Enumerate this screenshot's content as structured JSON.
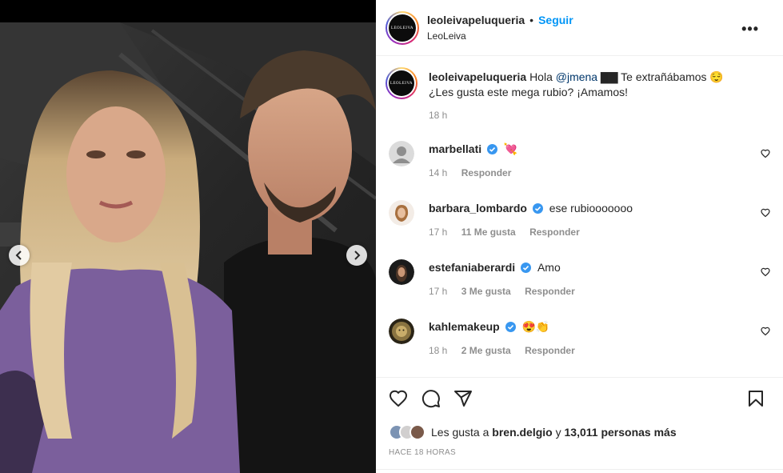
{
  "post": {
    "username": "leoleivapeluqueria",
    "follow_label": "Seguir",
    "subtitle": "LeoLeiva",
    "avatar_text": "LEOLEIVA",
    "more_label": "•••"
  },
  "caption": {
    "username": "leoleivapeluqueria",
    "text_before": "Hola ",
    "mention": "@jmena",
    "text_after": " ▇▇ Te extrañábamos 😌",
    "line2": "¿Les gusta este mega rubio? ¡Amamos!",
    "time": "18 h"
  },
  "comments": [
    {
      "username": "marbellati",
      "text": "💘",
      "time": "14 h",
      "likes": "",
      "reply": "Responder"
    },
    {
      "username": "barbara_lombardo",
      "text": "ese rubiooooooo",
      "time": "17 h",
      "likes": "11 Me gusta",
      "reply": "Responder"
    },
    {
      "username": "estefaniaberardi",
      "text": "Amo",
      "time": "17 h",
      "likes": "3 Me gusta",
      "reply": "Responder"
    },
    {
      "username": "kahlemakeup",
      "text": "😍👏",
      "time": "18 h",
      "likes": "2 Me gusta",
      "reply": "Responder"
    }
  ],
  "likes": {
    "prefix": "Les gusta a ",
    "user": "bren.delgio",
    "middle": " y ",
    "count": "13,011 personas más"
  },
  "time_ago": "HACE 18 HORAS",
  "colors": {
    "accent": "#0095f6",
    "verified": "#3897f0",
    "muted": "#8e8e8e",
    "text": "#262626"
  },
  "icons": [
    "chevron-left-icon",
    "chevron-right-icon",
    "more-icon",
    "verified-icon",
    "heart-icon",
    "comment-icon",
    "share-icon",
    "bookmark-icon"
  ]
}
